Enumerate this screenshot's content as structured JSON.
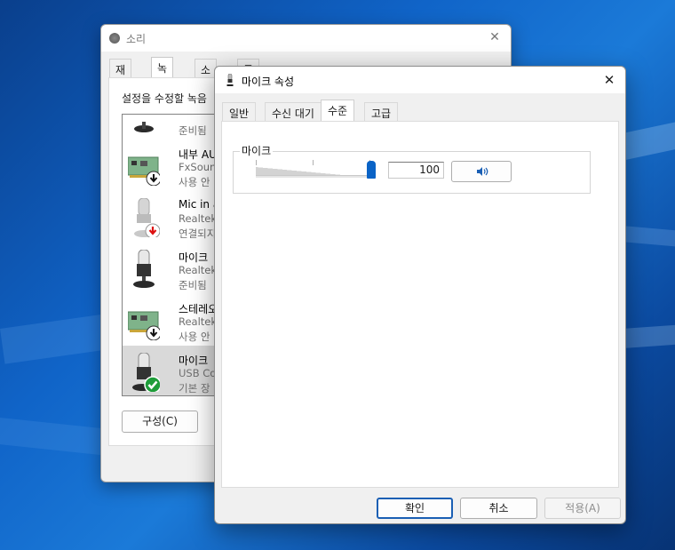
{
  "back_window": {
    "title": "소리",
    "tabs": [
      "재생",
      "녹음",
      "소리",
      "통신"
    ],
    "active_tab": "녹음",
    "description": "설정을 수정할 녹음",
    "devices": [
      {
        "name": "",
        "sub1": "",
        "sub2": "준비됨",
        "icon": "microphone-icon",
        "selected": false
      },
      {
        "name": "내부 AU",
        "sub1": "FxSoun",
        "sub2": "사용 안",
        "icon": "sound-card-icon",
        "badge": "down-arrow",
        "selected": false
      },
      {
        "name": "Mic in a",
        "sub1": "Realtek",
        "sub2": "연결되지",
        "icon": "microphone-icon",
        "badge": "red-down-arrow",
        "selected": false
      },
      {
        "name": "마이크",
        "sub1": "Realtek",
        "sub2": "준비됨",
        "icon": "microphone-icon",
        "selected": false
      },
      {
        "name": "스테레오",
        "sub1": "Realtek",
        "sub2": "사용 안",
        "icon": "sound-card-icon",
        "badge": "down-arrow",
        "selected": false
      },
      {
        "name": "마이크",
        "sub1": "USB Co",
        "sub2": "기본 장",
        "icon": "usb-microphone-icon",
        "badge": "green-check",
        "selected": true
      }
    ],
    "config_button": "구성(C)"
  },
  "front_window": {
    "title": "마이크 속성",
    "tabs": [
      "일반",
      "수신 대기",
      "수준",
      "고급"
    ],
    "active_tab": "수준",
    "group_label": "마이크",
    "level_value": "100",
    "level_fraction": 1.0,
    "buttons": {
      "ok": "확인",
      "cancel": "취소",
      "apply": "적용(A)"
    }
  },
  "colors": {
    "accent": "#0a63c6",
    "selected_row": "#d9d9d9"
  }
}
